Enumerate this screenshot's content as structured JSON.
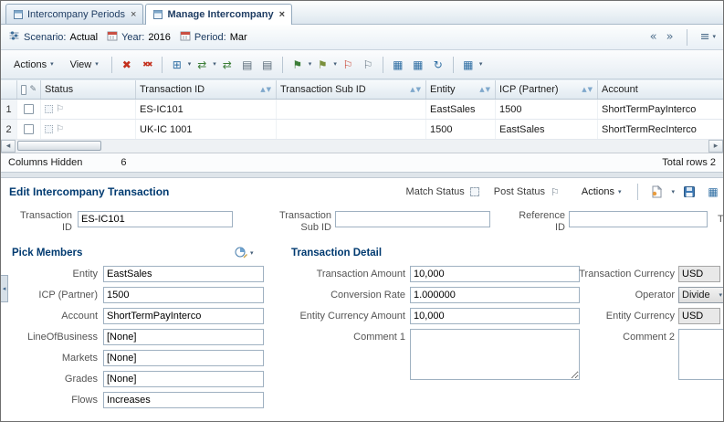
{
  "glyphs": {
    "close": "×",
    "caret": "▾",
    "prev": "«",
    "next": "»",
    "menu": "≡",
    "delete": "✖",
    "delete_all": "✖✖",
    "grid": "▦",
    "grid_plus": "⊞",
    "match": "⇄",
    "copy": "▤",
    "flag": "⚑",
    "flag_outline": "⚐",
    "refresh": "↻",
    "sort": "▲▼",
    "left_arrow": "◂",
    "right_arrow": "▸",
    "pencil": "✎",
    "question": "?"
  },
  "tabbar": {
    "tabs": [
      {
        "label": "Intercompany Periods"
      },
      {
        "label": "Manage Intercompany"
      }
    ]
  },
  "pov": {
    "scenario_label": "Scenario:",
    "scenario_value": "Actual",
    "year_label": "Year:",
    "year_value": "2016",
    "period_label": "Period:",
    "period_value": "Mar"
  },
  "toolbar": {
    "actions": "Actions",
    "view": "View"
  },
  "table": {
    "columns": [
      "Status",
      "Transaction ID",
      "Transaction Sub ID",
      "Entity",
      "ICP (Partner)",
      "Account"
    ],
    "rows": [
      {
        "num": "1",
        "transaction_id": "ES-IC101",
        "transaction_sub_id": "",
        "entity": "EastSales",
        "icp_partner": "1500",
        "account": "ShortTermPayInterco"
      },
      {
        "num": "2",
        "transaction_id": "UK-IC 1001",
        "transaction_sub_id": "",
        "entity": "1500",
        "icp_partner": "EastSales",
        "account": "ShortTermRecInterco"
      }
    ]
  },
  "statusbar": {
    "columns_hidden_label": "Columns Hidden",
    "columns_hidden_value": "6",
    "total_rows": "Total rows 2"
  },
  "edit": {
    "title": "Edit Intercompany Transaction",
    "match_status": "Match Status",
    "post_status": "Post Status",
    "actions": "Actions",
    "transaction_id_label": "Transaction ID",
    "transaction_id_value": "ES-IC101",
    "transaction_sub_id_label": "Transaction Sub ID",
    "transaction_sub_id_value": "",
    "reference_id_label": "Reference ID",
    "reference_id_value": "",
    "truncated_label": "T"
  },
  "pick_members": {
    "title": "Pick Members",
    "fields": [
      {
        "label": "Entity",
        "value": "EastSales"
      },
      {
        "label": "ICP (Partner)",
        "value": "1500"
      },
      {
        "label": "Account",
        "value": "ShortTermPayInterco"
      },
      {
        "label": "LineOfBusiness",
        "value": "[None]"
      },
      {
        "label": "Markets",
        "value": "[None]"
      },
      {
        "label": "Grades",
        "value": "[None]"
      },
      {
        "label": "Flows",
        "value": "Increases"
      }
    ]
  },
  "detail": {
    "title": "Transaction Detail",
    "amount_label": "Transaction Amount",
    "amount_value": "10,000",
    "rate_label": "Conversion Rate",
    "rate_value": "1.000000",
    "entity_amount_label": "Entity Currency Amount",
    "entity_amount_value": "10,000",
    "comment1_label": "Comment 1",
    "currency_label": "Transaction Currency",
    "currency_value": "USD",
    "operator_label": "Operator",
    "operator_value": "Divide",
    "entity_currency_label": "Entity Currency",
    "entity_currency_value": "USD",
    "comment2_label": "Comment 2"
  }
}
